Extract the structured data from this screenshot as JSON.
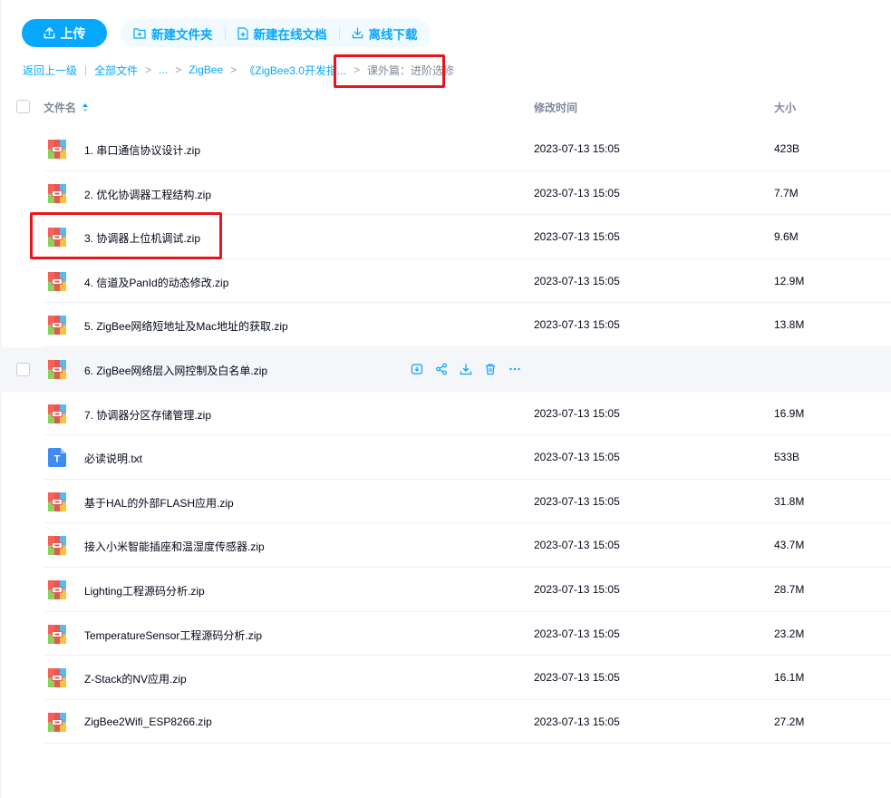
{
  "toolbar": {
    "upload_label": "上传",
    "actions": [
      {
        "label": "新建文件夹",
        "icon": "new-folder-icon"
      },
      {
        "label": "新建在线文档",
        "icon": "new-doc-icon"
      },
      {
        "label": "离线下载",
        "icon": "offline-download-icon"
      }
    ]
  },
  "breadcrumb": {
    "back": "返回上一级",
    "items": [
      "全部文件",
      "...",
      "ZigBee",
      "《ZigBee3.0开发指..."
    ],
    "current": "课外篇：进阶选修"
  },
  "table": {
    "headers": {
      "name": "文件名",
      "time": "修改时间",
      "size": "大小"
    },
    "rows": [
      {
        "name": "1. 串口通信协议设计.zip",
        "time": "2023-07-13 15:05",
        "size": "423B",
        "type": "zip"
      },
      {
        "name": "2. 优化协调器工程结构.zip",
        "time": "2023-07-13 15:05",
        "size": "7.7M",
        "type": "zip"
      },
      {
        "name": "3. 协调器上位机调试.zip",
        "time": "2023-07-13 15:05",
        "size": "9.6M",
        "type": "zip"
      },
      {
        "name": "4. 信道及PanId的动态修改.zip",
        "time": "2023-07-13 15:05",
        "size": "12.9M",
        "type": "zip"
      },
      {
        "name": "5. ZigBee网络短地址及Mac地址的获取.zip",
        "time": "2023-07-13 15:05",
        "size": "13.8M",
        "type": "zip"
      },
      {
        "name": "6. ZigBee网络层入网控制及白名单.zip",
        "time": "",
        "size": "",
        "type": "zip",
        "hover": true
      },
      {
        "name": "7. 协调器分区存储管理.zip",
        "time": "2023-07-13 15:05",
        "size": "16.9M",
        "type": "zip"
      },
      {
        "name": "必读说明.txt",
        "time": "2023-07-13 15:05",
        "size": "533B",
        "type": "txt"
      },
      {
        "name": "基于HAL的外部FLASH应用.zip",
        "time": "2023-07-13 15:05",
        "size": "31.8M",
        "type": "zip"
      },
      {
        "name": "接入小米智能插座和温湿度传感器.zip",
        "time": "2023-07-13 15:05",
        "size": "43.7M",
        "type": "zip"
      },
      {
        "name": "Lighting工程源码分析.zip",
        "time": "2023-07-13 15:05",
        "size": "28.7M",
        "type": "zip"
      },
      {
        "name": "TemperatureSensor工程源码分析.zip",
        "time": "2023-07-13 15:05",
        "size": "23.2M",
        "type": "zip"
      },
      {
        "name": "Z-Stack的NV应用.zip",
        "time": "2023-07-13 15:05",
        "size": "16.1M",
        "type": "zip"
      },
      {
        "name": "ZigBee2Wifi_ESP8266.zip",
        "time": "2023-07-13 15:05",
        "size": "27.2M",
        "type": "zip"
      }
    ],
    "hover_actions": [
      "save-to-icon",
      "share-icon",
      "download-icon",
      "delete-icon",
      "more-icon"
    ]
  },
  "colors": {
    "accent": "#06a7ff",
    "highlight_box": "#e8161c",
    "hover_row": "#f5f6fa"
  }
}
